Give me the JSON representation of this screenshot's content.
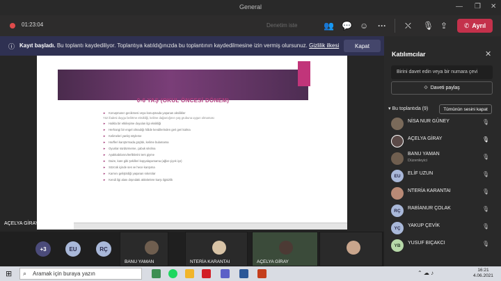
{
  "window": {
    "title": "General"
  },
  "toolbar": {
    "timer": "01:23:04",
    "ghost_label": "Denetim iste",
    "leave_label": "Ayrıl",
    "icons": [
      "participants-icon",
      "chat-icon",
      "reactions-icon",
      "more-icon",
      "camera-off-icon",
      "mic-off-icon",
      "share-icon",
      "phone-icon"
    ]
  },
  "banner": {
    "title": "Kayıt başladı.",
    "message": "Bu toplantı kaydediliyor. Toplantıya katıldığınızda bu toplantının kaydedilmesine izin vermiş olursunuz.",
    "link": "Gizlilik ilkesi",
    "close_label": "Kapat"
  },
  "slide": {
    "heading": "0-6 YAŞ (OKUL ÖNCESİ DÖNEM)",
    "bullets": [
      "Konuşmanın gecikmesi veya konuşmada yaşanan aksilikler",
      "Yüz ifadesi duygu belirtme eksikliği, kelime dağarcığının yaş grubuna uygun olmaması",
      "Halkla bir etkileşime duyulan ilgi eksikliği",
      "Herhangi bir engel olmadığı hâlde kendilerinden geri geri kalma",
      "Kelimeleri yanlış söyleme",
      "Harfleri karıştırmada güçlük, kelime bulamama",
      "Oyunlar sürdürmeme, çabuk sıkılma",
      "Ayakkabılarını/terliklerini ters giyme",
      "Daire, kare gibi şekilleri kopyalayamama (ağlar çiçek içe)",
      "Sözcük içinde ses ve hece karışıma",
      "Karnını geliştirdiği yaşanan sıkıntılar",
      "Kendi ilgi alanı dışındaki aktivitelere karşı ilgisizlik"
    ],
    "speaker_label": "AÇELYA GİRAY"
  },
  "strip": {
    "overflow": "+3",
    "avatars": [
      {
        "initials": "EU",
        "color": "#a9b8d9"
      },
      {
        "initials": "RÇ",
        "color": "#a9b8d9"
      }
    ],
    "tiles": [
      {
        "name": "BANU YAMAN"
      },
      {
        "name": "NTERİA KARANTAI"
      },
      {
        "name": "AÇELYA GİRAY"
      },
      {
        "name": ""
      }
    ]
  },
  "panel": {
    "title": "Katılımcılar",
    "invite_placeholder": "Birini davet edin veya bir numara çevi",
    "share_label": "Daveti paylaş",
    "section_label": "Bu toplantıda (9)",
    "mute_all_label": "Tümünün sesini kapat",
    "people": [
      {
        "name": "NİSA NUR GÜNEY",
        "initials": "",
        "role": "",
        "avatar_color": "#7a6a5a"
      },
      {
        "name": "AÇELYA GİRAY",
        "initials": "",
        "role": "",
        "avatar_color": "#5b4a48"
      },
      {
        "name": "BANU YAMAN",
        "initials": "",
        "role": "Düzenleyici",
        "avatar_color": "#6f5e4f"
      },
      {
        "name": "ELİF UZUN",
        "initials": "EU",
        "role": "",
        "avatar_color": "#a9b8d9"
      },
      {
        "name": "NTERİA KARANTAI",
        "initials": "",
        "role": "",
        "avatar_color": "#b98a76"
      },
      {
        "name": "RABİANUR ÇOLAK",
        "initials": "RÇ",
        "role": "",
        "avatar_color": "#a9b8d9"
      },
      {
        "name": "YAKUP ÇEVİK",
        "initials": "YÇ",
        "role": "",
        "avatar_color": "#a9b8d9"
      },
      {
        "name": "YUSUF BIÇAKCI",
        "initials": "YB",
        "role": "",
        "avatar_color": "#b7d9a9"
      }
    ]
  },
  "taskbar": {
    "search_placeholder": "Aramak için buraya yazın",
    "time": "16:21",
    "date": "4.06.2021"
  }
}
